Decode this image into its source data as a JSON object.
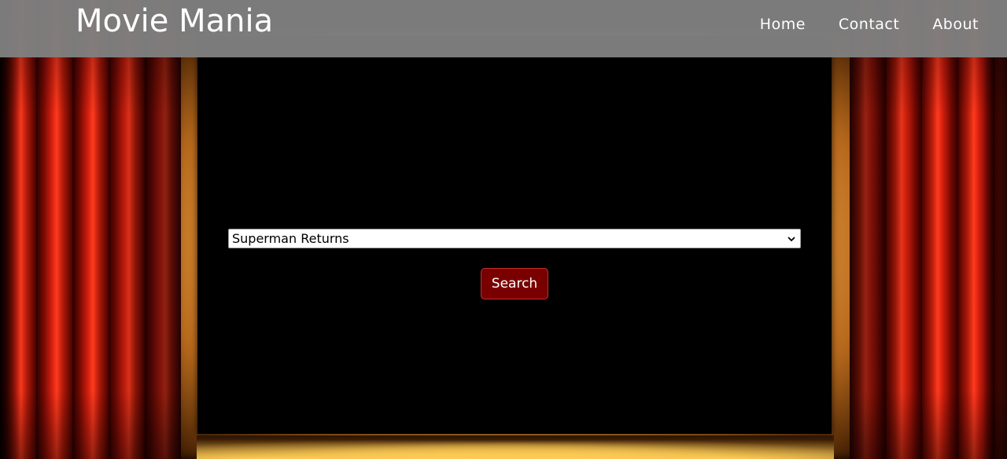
{
  "navbar": {
    "brand": "Movie Mania",
    "links": [
      {
        "label": "Home"
      },
      {
        "label": "Contact"
      },
      {
        "label": "About"
      }
    ]
  },
  "search": {
    "selected_movie": "Superman Returns",
    "button_label": "Search"
  },
  "colors": {
    "navbar_bg": "#808080",
    "button_bg": "#7a0000",
    "curtain_red": "#d4200f",
    "stage_glow": "#f2a94a"
  }
}
